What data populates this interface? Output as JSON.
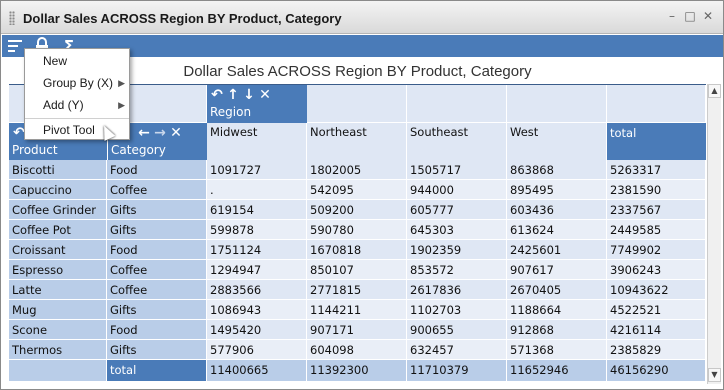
{
  "window": {
    "title": "Dollar Sales ACROSS Region BY Product, Category",
    "controls": {
      "minimize": "–",
      "maximize": "□",
      "close": "✕"
    }
  },
  "toolbar": {
    "menu_icon": "menu-lines-icon",
    "lock_icon": "lock-icon",
    "sum_icon": "sigma-icon",
    "sum_label": "Σ"
  },
  "menu": {
    "items": [
      {
        "label": "New",
        "has_submenu": false
      },
      {
        "label": "Group By (X)",
        "has_submenu": true
      },
      {
        "label": "Add (Y)",
        "has_submenu": true
      },
      {
        "label": "Pivot Tool",
        "has_submenu": false
      }
    ],
    "arrow": "▶"
  },
  "report": {
    "title": "Dollar Sales ACROSS Region BY Product, Category",
    "across_label": "Region",
    "by_labels": [
      "Product",
      "Category"
    ],
    "columns": [
      "Midwest",
      "Northeast",
      "Southeast",
      "West",
      "total"
    ],
    "pill_icons": {
      "undo": "↶",
      "up": "↑",
      "down": "↓",
      "close": "✕",
      "left": "←",
      "right": "→"
    },
    "rows": [
      {
        "product": "Biscotti",
        "category": "Food",
        "values": [
          "1091727",
          "1802005",
          "1505717",
          "863868",
          "5263317"
        ]
      },
      {
        "product": "Capuccino",
        "category": "Coffee",
        "values": [
          ".",
          "542095",
          "944000",
          "895495",
          "2381590"
        ]
      },
      {
        "product": "Coffee Grinder",
        "category": "Gifts",
        "values": [
          "619154",
          "509200",
          "605777",
          "603436",
          "2337567"
        ]
      },
      {
        "product": "Coffee Pot",
        "category": "Gifts",
        "values": [
          "599878",
          "590780",
          "645303",
          "613624",
          "2449585"
        ]
      },
      {
        "product": "Croissant",
        "category": "Food",
        "values": [
          "1751124",
          "1670818",
          "1902359",
          "2425601",
          "7749902"
        ]
      },
      {
        "product": "Espresso",
        "category": "Coffee",
        "values": [
          "1294947",
          "850107",
          "853572",
          "907617",
          "3906243"
        ]
      },
      {
        "product": "Latte",
        "category": "Coffee",
        "values": [
          "2883566",
          "2771815",
          "2617836",
          "2670405",
          "10943622"
        ]
      },
      {
        "product": "Mug",
        "category": "Gifts",
        "values": [
          "1086943",
          "1144211",
          "1102703",
          "1188664",
          "4522521"
        ]
      },
      {
        "product": "Scone",
        "category": "Food",
        "values": [
          "1495420",
          "907171",
          "900655",
          "912868",
          "4216114"
        ]
      },
      {
        "product": "Thermos",
        "category": "Gifts",
        "values": [
          "577906",
          "604098",
          "632457",
          "571368",
          "2385829"
        ]
      }
    ],
    "total_row": {
      "label": "total",
      "values": [
        "11400665",
        "11392300",
        "11710379",
        "11652946",
        "46156290"
      ]
    }
  },
  "colors": {
    "header_blue": "#4a7bb8",
    "dim_blue": "#b9cde8",
    "value_light": "#dfe7f4"
  }
}
